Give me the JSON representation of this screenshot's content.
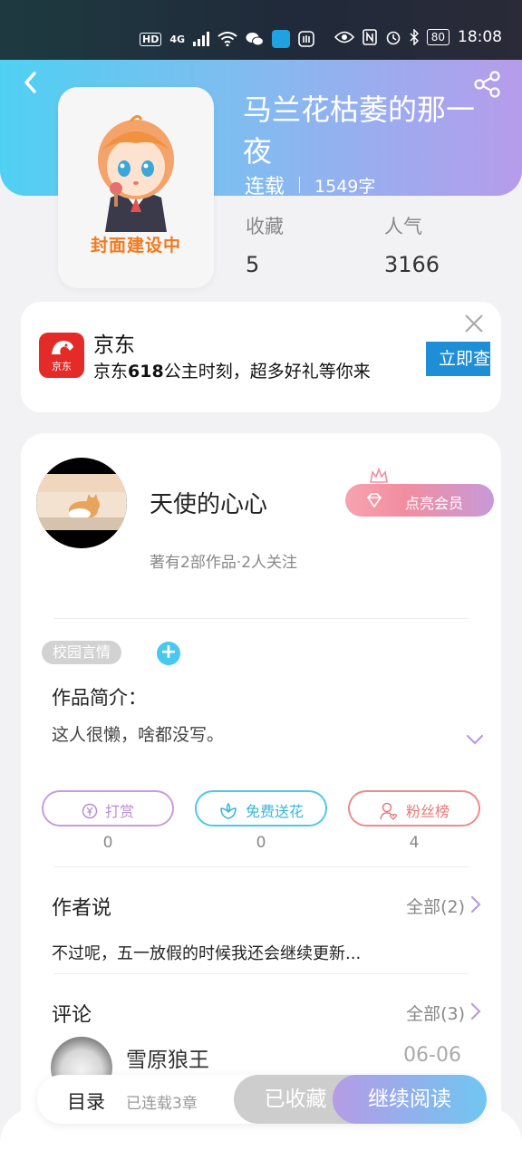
{
  "status_bar": {
    "left_icons": [
      "HD",
      "4G",
      "signal-icon",
      "wifi-icon",
      "wechat-icon",
      "app-icon",
      "hand-icon"
    ],
    "hd": "HD",
    "net": "4G",
    "battery": "80",
    "time": "18:08"
  },
  "book": {
    "title": "马兰花枯萎的那一夜",
    "status": "连载",
    "words": "1549字",
    "cover_caption": "封面建设中",
    "stats": [
      {
        "label": "收藏",
        "value": "5"
      },
      {
        "label": "人气",
        "value": "3166"
      }
    ]
  },
  "ad": {
    "logo_text": "京东",
    "name": "京东",
    "desc_prefix": "京东",
    "desc_bold": "618",
    "desc_suffix": "公主时刻，超多好礼等你来",
    "cta": "立即查看"
  },
  "author": {
    "name": "天使的心心",
    "sub": "著有2部作品·2人关注",
    "vip_label": "点亮会员"
  },
  "tags": [
    "校园言情"
  ],
  "intro": {
    "title": "作品简介：",
    "text": "这人很懒，啥都没写。"
  },
  "actions": [
    {
      "label": "打赏",
      "count": "0",
      "color": "#c99be0"
    },
    {
      "label": "免费送花",
      "count": "0",
      "color": "#4cc9e6"
    },
    {
      "label": "粉丝榜",
      "count": "4",
      "color": "#ee8b8b"
    }
  ],
  "author_says": {
    "title": "作者说",
    "all": "全部(2)",
    "text": "不过呢，五一放假的时候我还会继续更新..."
  },
  "comments": {
    "title": "评论",
    "all": "全部(3)",
    "first": {
      "name": "雪原狼王",
      "date": "06-06"
    }
  },
  "bottom": {
    "toc": "目录",
    "count": "已连载3章",
    "fav": "已收藏",
    "read": "继续阅读"
  },
  "colors": {
    "hero_start": "#4fd0f2",
    "hero_end": "#b79cec",
    "accent_purple": "#b59be6",
    "accent_cyan": "#6fc6f1",
    "ad_red": "#e42b28",
    "ad_blue": "#1e8ed6"
  }
}
